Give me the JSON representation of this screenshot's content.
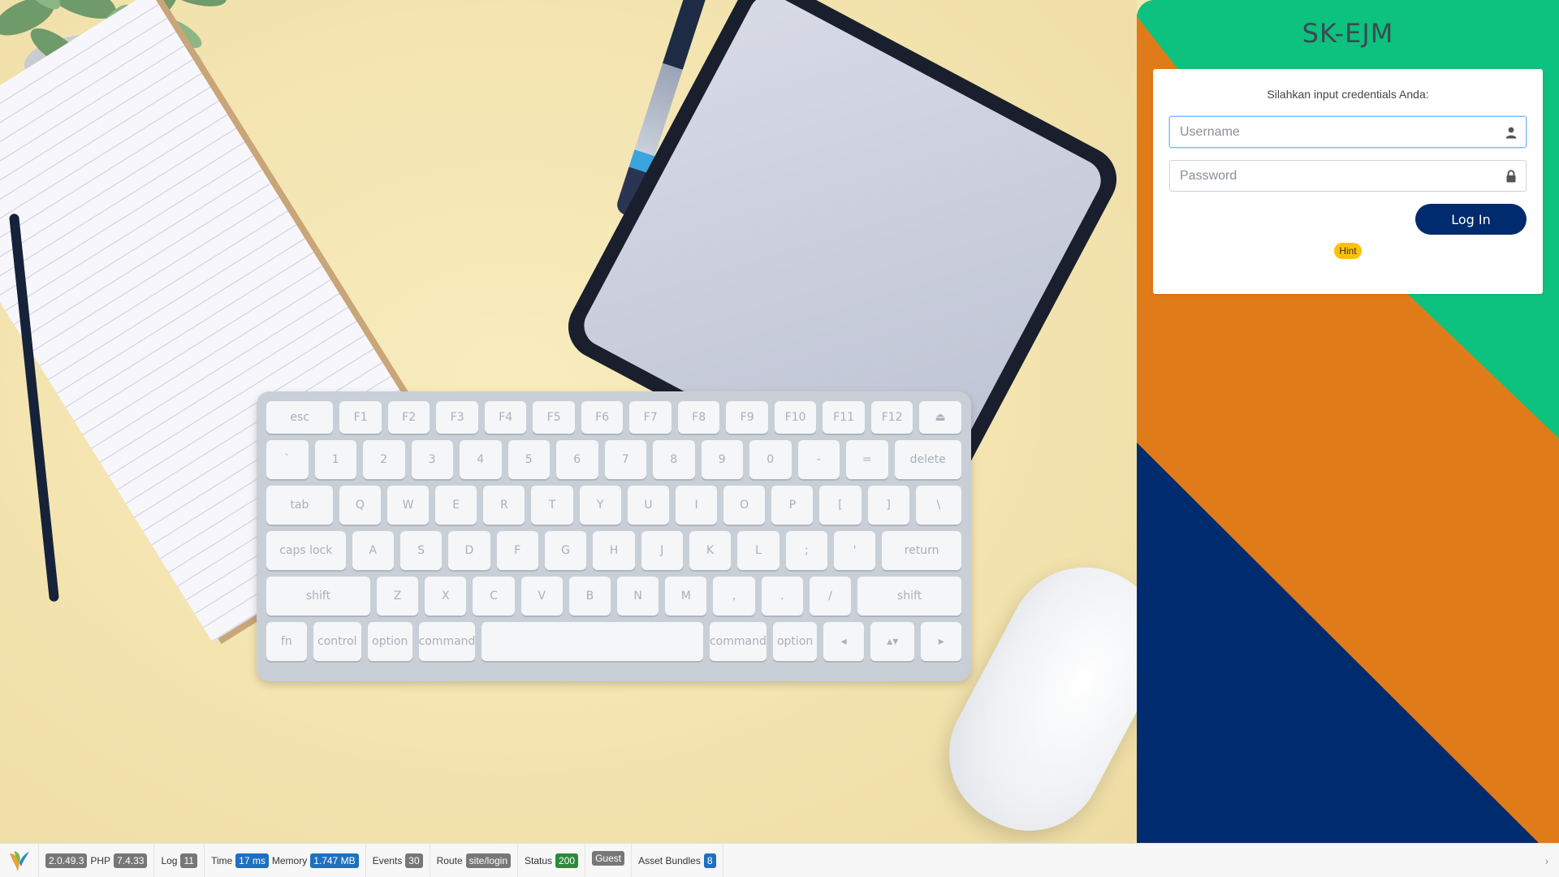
{
  "brand": {
    "title": "SK-EJM"
  },
  "login": {
    "prompt": "Silahkan input credentials Anda:",
    "username_placeholder": "Username",
    "password_placeholder": "Password",
    "login_label": "Log In",
    "hint_label": "Hint"
  },
  "icons": {
    "user": "user-icon",
    "lock": "lock-icon",
    "framework_logo": "yii-logo-icon"
  },
  "colors": {
    "orange": "#E07B1A",
    "green": "#0CC27E",
    "navy": "#002B6E",
    "hint": "#FFC107"
  },
  "keyboard": {
    "row1": [
      "esc",
      "F1",
      "F2",
      "F3",
      "F4",
      "F5",
      "F6",
      "F7",
      "F8",
      "F9",
      "F10",
      "F11",
      "F12",
      "⏏"
    ],
    "row2": [
      "`",
      "1",
      "2",
      "3",
      "4",
      "5",
      "6",
      "7",
      "8",
      "9",
      "0",
      "-",
      "=",
      "delete"
    ],
    "row3": [
      "tab",
      "Q",
      "W",
      "E",
      "R",
      "T",
      "Y",
      "U",
      "I",
      "O",
      "P",
      "[",
      "]",
      "\\"
    ],
    "row4": [
      "caps lock",
      "A",
      "S",
      "D",
      "F",
      "G",
      "H",
      "J",
      "K",
      "L",
      ";",
      "'",
      "return"
    ],
    "row5": [
      "shift",
      "Z",
      "X",
      "C",
      "V",
      "B",
      "N",
      "M",
      ",",
      ".",
      "/",
      "shift"
    ],
    "row6": [
      "fn",
      "control",
      "option",
      "command",
      "",
      "command",
      "option",
      "◂",
      "▴▾",
      "▸"
    ]
  },
  "debugbar": {
    "yii_version": "2.0.49.3",
    "php_label": "PHP",
    "php_version": "7.4.33",
    "log_label": "Log",
    "log_count": "11",
    "time_label": "Time",
    "time_value": "17 ms",
    "memory_label": "Memory",
    "memory_value": "1.747 MB",
    "events_label": "Events",
    "events_count": "30",
    "route_label": "Route",
    "route_value": "site/login",
    "status_label": "Status",
    "status_value": "200",
    "user_value": "Guest",
    "asset_label": "Asset Bundles",
    "asset_count": "8",
    "toggle": "›"
  }
}
